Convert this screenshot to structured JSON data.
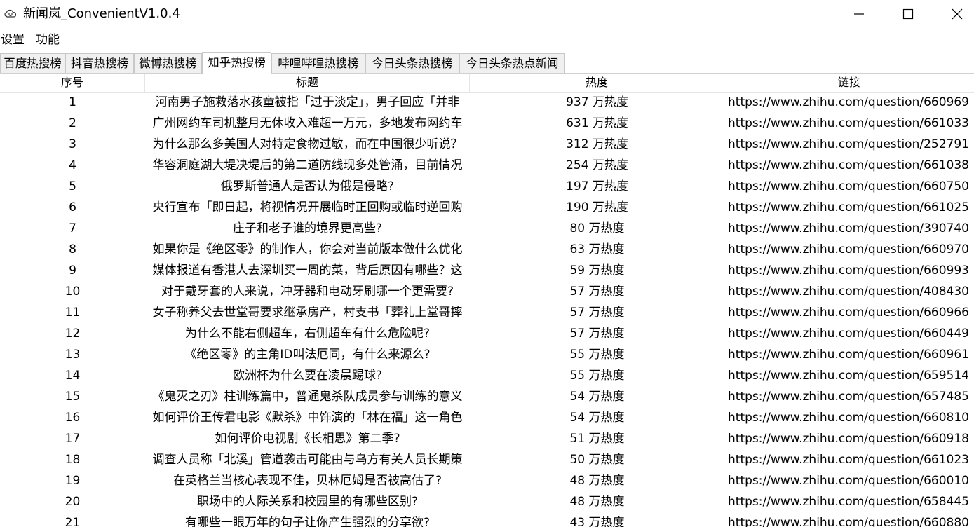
{
  "window": {
    "title": "新闻岚_ConvenientV1.0.4",
    "icon": "cloud-face-icon"
  },
  "menu": [
    "设置",
    "功能"
  ],
  "tabs": [
    {
      "label": "百度热搜榜",
      "selected": false
    },
    {
      "label": "抖音热搜榜",
      "selected": false
    },
    {
      "label": "微博热搜榜",
      "selected": false
    },
    {
      "label": "知乎热搜榜",
      "selected": true
    },
    {
      "label": "哔哩哔哩热搜榜",
      "selected": false
    },
    {
      "label": "今日头条热搜榜",
      "selected": false
    },
    {
      "label": "今日头条热点新闻",
      "selected": false
    }
  ],
  "table": {
    "columns": [
      "序号",
      "标题",
      "热度",
      "链接"
    ],
    "rows": [
      {
        "idx": "1",
        "title": "河南男子施救落水孩童被指「过于淡定」，男子回应「并非",
        "heat": "937 万热度",
        "link": "https://www.zhihu.com/question/660969"
      },
      {
        "idx": "2",
        "title": "广州网约车司机整月无休收入难超一万元，多地发布网约车",
        "heat": "631 万热度",
        "link": "https://www.zhihu.com/question/661033"
      },
      {
        "idx": "3",
        "title": "为什么那么多美国人对特定食物过敏，而在中国很少听说？",
        "heat": "312 万热度",
        "link": "https://www.zhihu.com/question/252791"
      },
      {
        "idx": "4",
        "title": "华容洞庭湖大堤决堤后的第二道防线现多处管涌，目前情况",
        "heat": "254 万热度",
        "link": "https://www.zhihu.com/question/661038"
      },
      {
        "idx": "5",
        "title": "俄罗斯普通人是否认为俄是侵略?",
        "heat": "197 万热度",
        "link": "https://www.zhihu.com/question/660750"
      },
      {
        "idx": "6",
        "title": "央行宣布「即日起，将视情况开展临时正回购或临时逆回购",
        "heat": "190 万热度",
        "link": "https://www.zhihu.com/question/661025"
      },
      {
        "idx": "7",
        "title": "庄子和老子谁的境界更高些?",
        "heat": "80 万热度",
        "link": "https://www.zhihu.com/question/390740"
      },
      {
        "idx": "8",
        "title": "如果你是《绝区零》的制作人，你会对当前版本做什么优化",
        "heat": "63 万热度",
        "link": "https://www.zhihu.com/question/660970"
      },
      {
        "idx": "9",
        "title": "媒体报道有香港人去深圳买一周的菜，背后原因有哪些？这",
        "heat": "59 万热度",
        "link": "https://www.zhihu.com/question/660993"
      },
      {
        "idx": "10",
        "title": "对于戴牙套的人来说，冲牙器和电动牙刷哪一个更需要?",
        "heat": "57 万热度",
        "link": "https://www.zhihu.com/question/408430"
      },
      {
        "idx": "11",
        "title": "女子称养父去世堂哥要求继承房产，村支书「葬礼上堂哥摔",
        "heat": "57 万热度",
        "link": "https://www.zhihu.com/question/660966"
      },
      {
        "idx": "12",
        "title": "为什么不能右侧超车，右侧超车有什么危险呢?",
        "heat": "57 万热度",
        "link": "https://www.zhihu.com/question/660449"
      },
      {
        "idx": "13",
        "title": "《绝区零》的主角ID叫法厄同，有什么来源么?",
        "heat": "55 万热度",
        "link": "https://www.zhihu.com/question/660961"
      },
      {
        "idx": "14",
        "title": "欧洲杯为什么要在凌晨踢球?",
        "heat": "55 万热度",
        "link": "https://www.zhihu.com/question/659514"
      },
      {
        "idx": "15",
        "title": "《鬼灭之刃》柱训练篇中，普通鬼杀队成员参与训练的意义",
        "heat": "54 万热度",
        "link": "https://www.zhihu.com/question/657485"
      },
      {
        "idx": "16",
        "title": "如何评价王传君电影《默杀》中饰演的「林在福」这一角色",
        "heat": "54 万热度",
        "link": "https://www.zhihu.com/question/660810"
      },
      {
        "idx": "17",
        "title": "如何评价电视剧《长相思》第二季?",
        "heat": "51 万热度",
        "link": "https://www.zhihu.com/question/660918"
      },
      {
        "idx": "18",
        "title": "调查人员称「北溪」管道袭击可能由与乌方有关人员长期策",
        "heat": "50 万热度",
        "link": "https://www.zhihu.com/question/661023"
      },
      {
        "idx": "19",
        "title": "在英格兰当核心表现不佳，贝林厄姆是否被高估了?",
        "heat": "48 万热度",
        "link": "https://www.zhihu.com/question/660010"
      },
      {
        "idx": "20",
        "title": "职场中的人际关系和校园里的有哪些区别?",
        "heat": "48 万热度",
        "link": "https://www.zhihu.com/question/658445"
      },
      {
        "idx": "21",
        "title": "有哪些一眼万年的句子让你产生强烈的分享欲?",
        "heat": "43 万热度",
        "link": "https://www.zhihu.com/question/660880"
      }
    ]
  }
}
